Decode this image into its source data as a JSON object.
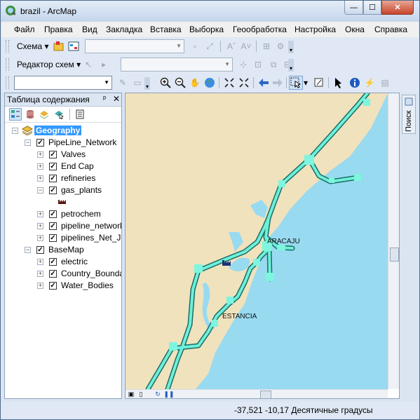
{
  "window": {
    "title": "brazil - ArcMap",
    "minimize": "—",
    "maximize": "☐",
    "close": "✕"
  },
  "menu": [
    "Файл",
    "Правка",
    "Вид",
    "Закладка",
    "Вставка",
    "Выборка",
    "Геообработка",
    "Настройка",
    "Окна",
    "Справка"
  ],
  "toolbar": {
    "schema_label": "Схема ▾",
    "editor_label": "Редактор схем ▾"
  },
  "toc": {
    "title": "Таблица содержания",
    "pin": "ᵖ",
    "close": "✕",
    "items": [
      {
        "label": "Geography",
        "expander": "−",
        "checked": "✓"
      },
      {
        "label": "PipeLine_Network",
        "expander": "−",
        "checked": "✓"
      },
      {
        "label": "Valves",
        "expander": "+",
        "checked": "✓"
      },
      {
        "label": "End Cap",
        "expander": "+",
        "checked": "✓"
      },
      {
        "label": "refineries",
        "expander": "+",
        "checked": "✓"
      },
      {
        "label": "gas_plants",
        "expander": "−",
        "checked": "✓"
      },
      {
        "label": "petrochem",
        "expander": "+",
        "checked": "✓"
      },
      {
        "label": "pipeline_network",
        "expander": "+",
        "checked": "✓"
      },
      {
        "label": "pipelines_Net_Ju",
        "expander": "+",
        "checked": "✓"
      },
      {
        "label": "BaseMap",
        "expander": "−",
        "checked": "✓"
      },
      {
        "label": "electric",
        "expander": "+",
        "checked": "✓"
      },
      {
        "label": "Country_Bounda",
        "expander": "+",
        "checked": "✓"
      },
      {
        "label": "Water_Bodies",
        "expander": "+",
        "checked": "✓"
      }
    ]
  },
  "map": {
    "labels": [
      "ARACAJU",
      "ESTANCIA"
    ],
    "colors": {
      "land": "#f0e2bd",
      "water": "#98daf0",
      "pipeline": "#6ff0d8",
      "pipeline_edge": "#1a6d68",
      "node": "#7ef5df"
    }
  },
  "search_tab": {
    "label": "Поиск"
  },
  "status": {
    "coords": "-37,521  -10,17 Десятичные градусы"
  }
}
